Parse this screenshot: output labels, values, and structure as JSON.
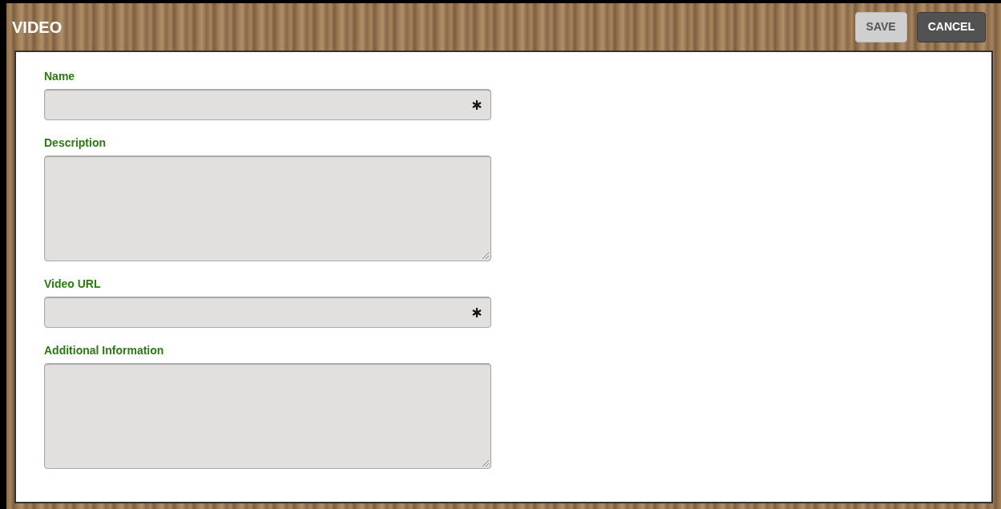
{
  "window": {
    "title": "VIDEO"
  },
  "buttons": [
    {
      "label": "SAVE",
      "kind": "secondary"
    },
    {
      "label": "CANCEL",
      "kind": "primary"
    }
  ],
  "fields": [
    {
      "label": "Name",
      "kind": "input",
      "required": true
    },
    {
      "label": "Description",
      "kind": "textarea",
      "required": false
    },
    {
      "label": "Video URL",
      "kind": "input",
      "required": true
    },
    {
      "label": "Additional Information",
      "kind": "textarea",
      "required": false
    }
  ]
}
